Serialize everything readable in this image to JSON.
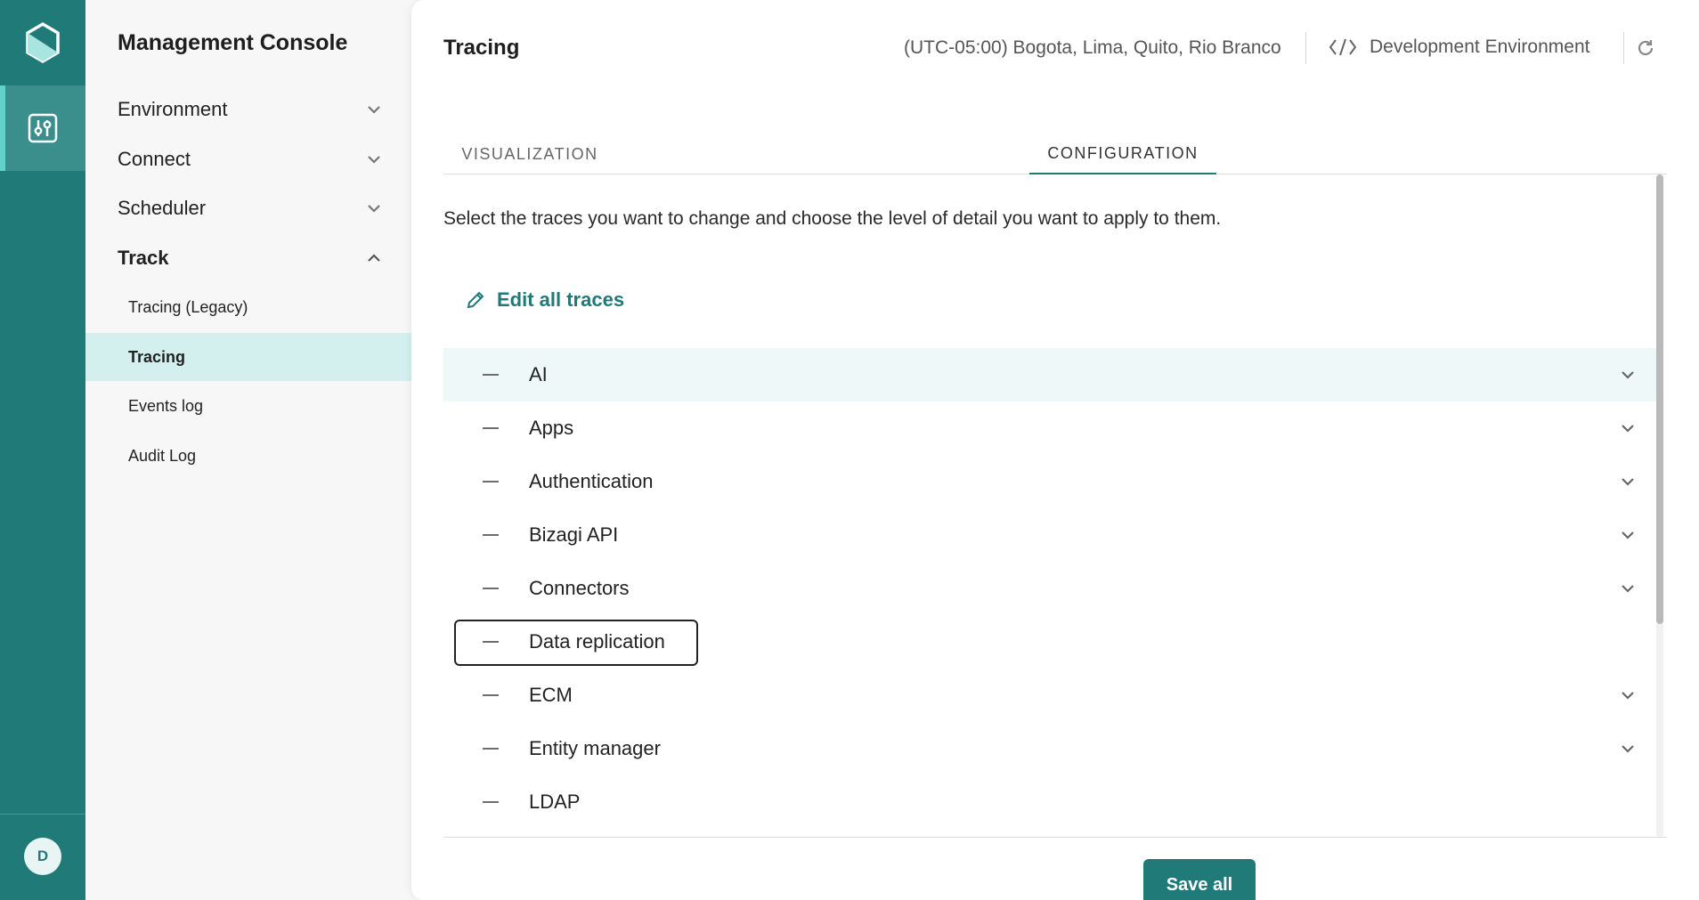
{
  "rail": {
    "avatar_initial": "D",
    "accent": "#1f7a78"
  },
  "sidenav": {
    "title": "Management Console",
    "groups": [
      {
        "label": "Environment",
        "expanded": false
      },
      {
        "label": "Connect",
        "expanded": false
      },
      {
        "label": "Scheduler",
        "expanded": false
      },
      {
        "label": "Track",
        "expanded": true
      }
    ],
    "track_items": [
      {
        "label": "Tracing (Legacy)",
        "active": false
      },
      {
        "label": "Tracing",
        "active": true
      },
      {
        "label": "Events log",
        "active": false
      },
      {
        "label": "Audit Log",
        "active": false
      }
    ]
  },
  "header": {
    "title": "Tracing",
    "timezone": "(UTC-05:00) Bogota, Lima, Quito, Rio Branco",
    "environment": "Development Environment"
  },
  "tabs": [
    {
      "label": "VISUALIZATION",
      "active": false
    },
    {
      "label": "CONFIGURATION",
      "active": true
    }
  ],
  "configuration": {
    "description": "Select the traces you want to change and choose the level of detail you want to apply to them.",
    "edit_all_label": "Edit all traces",
    "traces": [
      {
        "label": "AI",
        "expandable": true,
        "highlighted": true
      },
      {
        "label": "Apps",
        "expandable": true
      },
      {
        "label": "Authentication",
        "expandable": true
      },
      {
        "label": "Bizagi API",
        "expandable": true
      },
      {
        "label": "Connectors",
        "expandable": true
      },
      {
        "label": "Data replication",
        "expandable": false,
        "focused": true
      },
      {
        "label": "ECM",
        "expandable": true
      },
      {
        "label": "Entity manager",
        "expandable": true
      },
      {
        "label": "LDAP",
        "expandable": false
      }
    ]
  },
  "footer": {
    "save_all_label": "Save all"
  }
}
